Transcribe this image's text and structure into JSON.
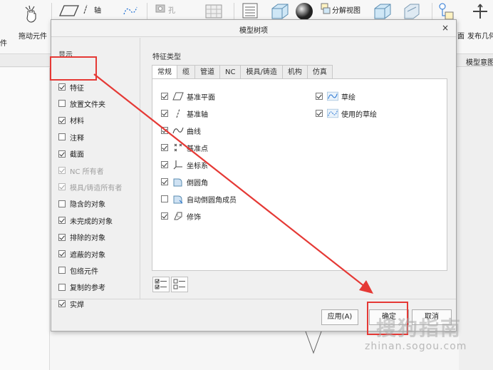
{
  "ribbon": {
    "drag_component": "拖动元件",
    "left_cut": "件",
    "axis": "轴",
    "hole": "孔",
    "explode_view": "分解视图",
    "face_cut": "面",
    "publish_geom": "发布几何",
    "model_intent": "模型意图"
  },
  "dialog": {
    "title": "模型树项",
    "close": "×",
    "display_title": "显示",
    "feature_type_title": "特征类型",
    "display_items": [
      {
        "label": "特征",
        "checked": true,
        "disabled": false
      },
      {
        "label": "放置文件夹",
        "checked": false,
        "disabled": false
      },
      {
        "label": "材料",
        "checked": true,
        "disabled": false
      },
      {
        "label": "注释",
        "checked": false,
        "disabled": false
      },
      {
        "label": "截面",
        "checked": true,
        "disabled": false
      },
      {
        "label": "NC 所有者",
        "checked": true,
        "disabled": true
      },
      {
        "label": "模具/铸造所有者",
        "checked": true,
        "disabled": true
      },
      {
        "label": "隐含的对象",
        "checked": false,
        "disabled": false
      },
      {
        "label": "未完成的对象",
        "checked": true,
        "disabled": false
      },
      {
        "label": "排除的对象",
        "checked": true,
        "disabled": false
      },
      {
        "label": "遮蔽的对象",
        "checked": true,
        "disabled": false
      },
      {
        "label": "包络元件",
        "checked": false,
        "disabled": false
      },
      {
        "label": "复制的参考",
        "checked": false,
        "disabled": false
      },
      {
        "label": "实焊",
        "checked": true,
        "disabled": false
      }
    ],
    "tabs": [
      "常规",
      "缆",
      "管道",
      "NC",
      "模具/铸造",
      "机构",
      "仿真"
    ],
    "features_left": [
      {
        "label": "基准平面",
        "checked": true,
        "icon": "datum-plane-icon"
      },
      {
        "label": "基准轴",
        "checked": true,
        "icon": "datum-axis-icon"
      },
      {
        "label": "曲线",
        "checked": true,
        "icon": "curve-icon"
      },
      {
        "label": "基准点",
        "checked": true,
        "icon": "datum-point-icon"
      },
      {
        "label": "坐标系",
        "checked": true,
        "icon": "coordinate-system-icon"
      },
      {
        "label": "倒圆角",
        "checked": true,
        "icon": "round-icon"
      },
      {
        "label": "自动倒圆角成员",
        "checked": false,
        "icon": "auto-round-icon"
      },
      {
        "label": "修饰",
        "checked": true,
        "icon": "cosmetic-icon"
      }
    ],
    "features_right": [
      {
        "label": "草绘",
        "checked": true,
        "icon": "sketch-icon"
      },
      {
        "label": "使用的草绘",
        "checked": true,
        "icon": "used-sketch-icon"
      }
    ],
    "buttons": {
      "apply": "应用(A)",
      "ok": "确定",
      "cancel": "取消"
    }
  },
  "watermark": {
    "cn": "搜狗指南",
    "en": "zhinan.sogou.com"
  },
  "colors": {
    "highlight": "#e53935",
    "accent_blue": "#1f6fd1"
  }
}
